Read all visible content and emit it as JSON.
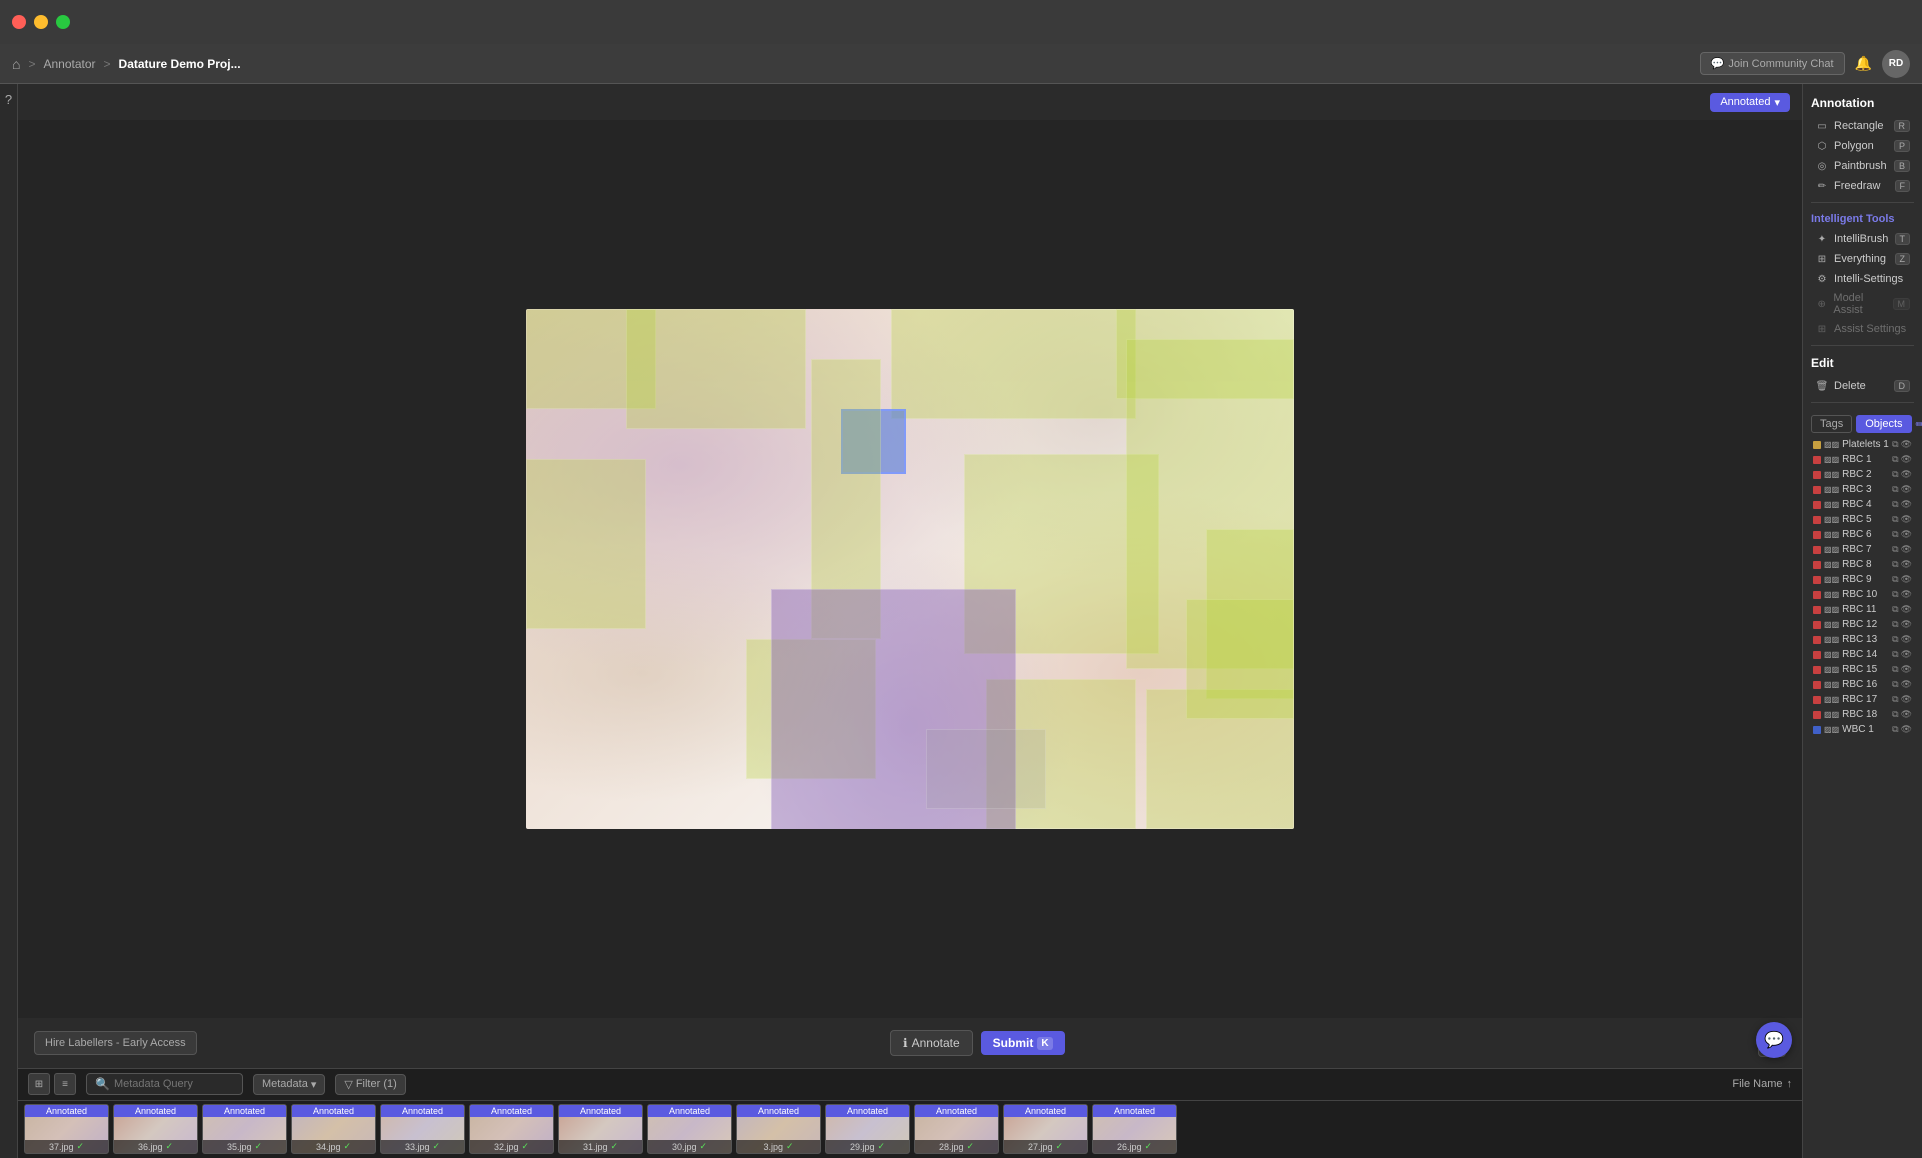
{
  "titlebar": {
    "traffic_lights": [
      "red",
      "yellow",
      "green"
    ]
  },
  "navbar": {
    "home_icon": "⌂",
    "separator": ">",
    "annotator_link": "Annotator",
    "project_name": "Datature Demo Proj...",
    "community_btn": "Join Community Chat",
    "community_icon": "💬",
    "user_initials": "RD"
  },
  "canvas": {
    "annotated_label": "Annotated",
    "dropdown_icon": "▾",
    "hire_btn": "Hire Labellers - Early Access",
    "annotate_btn": "Annotate",
    "annotate_icon": "ℹ",
    "submit_btn": "Submit",
    "submit_key": "K",
    "settings_icon": "⚙"
  },
  "annotation_panel": {
    "section_title": "Annotation",
    "tools": [
      {
        "name": "Rectangle",
        "icon": "rect",
        "key": "R"
      },
      {
        "name": "Polygon",
        "icon": "poly",
        "key": "P"
      },
      {
        "name": "Paintbrush",
        "icon": "brush",
        "key": "B"
      },
      {
        "name": "Freedraw",
        "icon": "pen",
        "key": "F"
      }
    ],
    "intelligent_label": "Intelligent Tools",
    "intelligent_tools": [
      {
        "name": "IntelliBrush",
        "icon": "smart",
        "key": "T"
      },
      {
        "name": "Everything",
        "icon": "everything",
        "key": "Z"
      },
      {
        "name": "Intelli-Settings",
        "icon": "settings",
        "key": ""
      },
      {
        "name": "Model Assist",
        "icon": "model",
        "key": "M",
        "disabled": true
      },
      {
        "name": "Assist Settings",
        "icon": "assist",
        "key": "",
        "disabled": true
      }
    ],
    "edit_title": "Edit",
    "delete_label": "Delete",
    "delete_key": "D",
    "tabs": [
      "Tags",
      "Objects"
    ],
    "active_tab": "Objects",
    "objects": [
      {
        "name": "Platelets 1",
        "color": "#c8a040"
      },
      {
        "name": "RBC 1",
        "color": "#c84040"
      },
      {
        "name": "RBC 2",
        "color": "#c84040"
      },
      {
        "name": "RBC 3",
        "color": "#c84040"
      },
      {
        "name": "RBC 4",
        "color": "#c84040"
      },
      {
        "name": "RBC 5",
        "color": "#c84040"
      },
      {
        "name": "RBC 6",
        "color": "#c84040"
      },
      {
        "name": "RBC 7",
        "color": "#c84040"
      },
      {
        "name": "RBC 8",
        "color": "#c84040"
      },
      {
        "name": "RBC 9",
        "color": "#c84040"
      },
      {
        "name": "RBC 10",
        "color": "#c84040"
      },
      {
        "name": "RBC 11",
        "color": "#c84040"
      },
      {
        "name": "RBC 12",
        "color": "#c84040"
      },
      {
        "name": "RBC 13",
        "color": "#c84040"
      },
      {
        "name": "RBC 14",
        "color": "#c84040"
      },
      {
        "name": "RBC 15",
        "color": "#c84040"
      },
      {
        "name": "RBC 16",
        "color": "#c84040"
      },
      {
        "name": "RBC 17",
        "color": "#c84040"
      },
      {
        "name": "RBC 18",
        "color": "#c84040"
      },
      {
        "name": "WBC 1",
        "color": "#4060c8"
      }
    ]
  },
  "filmstrip": {
    "search_placeholder": "Metadata Query",
    "metadata_btn": "Metadata",
    "filter_btn": "Filter (1)",
    "filename_sort": "File Name",
    "images": [
      {
        "label": "37.jpg",
        "badge": "Annotated",
        "checked": true
      },
      {
        "label": "36.jpg",
        "badge": "Annotated",
        "checked": true
      },
      {
        "label": "35.jpg",
        "badge": "Annotated",
        "checked": true
      },
      {
        "label": "34.jpg",
        "badge": "Annotated",
        "checked": true
      },
      {
        "label": "33.jpg",
        "badge": "Annotated",
        "checked": true
      },
      {
        "label": "32.jpg",
        "badge": "Annotated",
        "checked": true
      },
      {
        "label": "31.jpg",
        "badge": "Annotated",
        "checked": true
      },
      {
        "label": "30.jpg",
        "badge": "Annotated",
        "checked": true
      },
      {
        "label": "3.jpg",
        "badge": "Annotated",
        "checked": true
      },
      {
        "label": "29.jpg",
        "badge": "Annotated",
        "checked": true
      },
      {
        "label": "28.jpg",
        "badge": "Annotated",
        "checked": true
      },
      {
        "label": "27.jpg",
        "badge": "Annotated",
        "checked": true
      },
      {
        "label": "26.jpg",
        "badge": "Annotated",
        "checked": true
      }
    ]
  },
  "icons": {
    "search": "🔍",
    "filter": "▽",
    "sort_asc": "↑",
    "eye": "👁",
    "copy": "⧉",
    "pencil": "✏",
    "grid": "⊞",
    "list": "≡",
    "chat": "💬"
  }
}
